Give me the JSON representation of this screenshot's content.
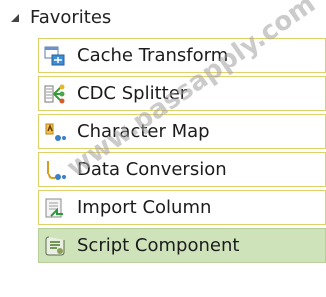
{
  "group": {
    "title": "Favorites",
    "expanded_icon": "triangle-expanded-icon"
  },
  "items": [
    {
      "label": "Cache Transform",
      "icon": "cache-transform-icon",
      "selected": false
    },
    {
      "label": "CDC Splitter",
      "icon": "cdc-splitter-icon",
      "selected": false
    },
    {
      "label": "Character Map",
      "icon": "character-map-icon",
      "selected": false
    },
    {
      "label": "Data Conversion",
      "icon": "data-conversion-icon",
      "selected": false
    },
    {
      "label": "Import Column",
      "icon": "import-column-icon",
      "selected": false
    },
    {
      "label": "Script Component",
      "icon": "script-component-icon",
      "selected": true
    }
  ],
  "watermark": "www.passapply.com",
  "colors": {
    "item_border": "#e0d06a",
    "selected_bg": "#cfe3bb"
  }
}
